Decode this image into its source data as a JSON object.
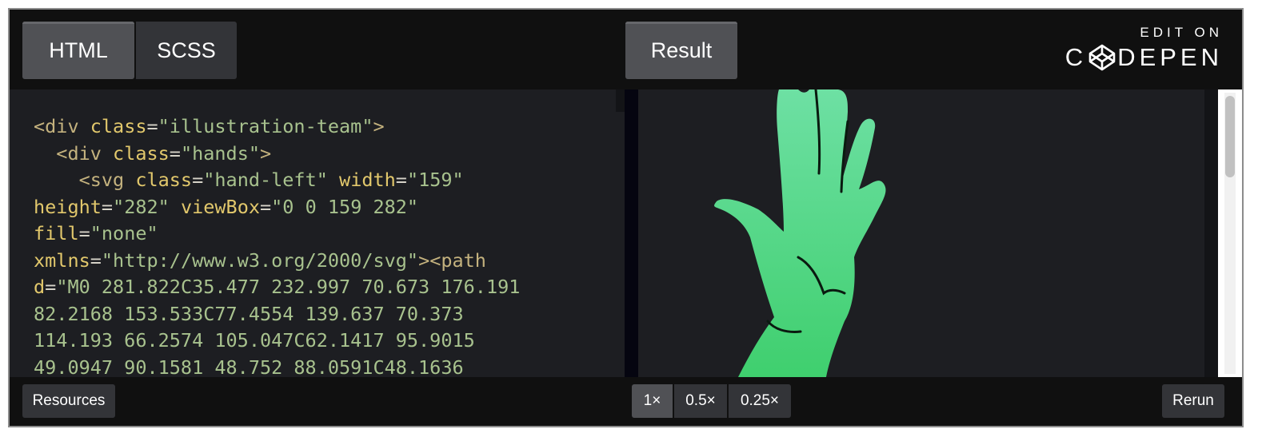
{
  "tabs": {
    "html": "HTML",
    "scss": "SCSS",
    "result": "Result"
  },
  "brand": {
    "edit_on": "EDIT ON",
    "codepen_prefix": "C",
    "codepen_suffix": "DEPEN"
  },
  "code_lines": [
    [
      [
        "tg",
        "<div "
      ],
      [
        "at",
        "class"
      ],
      [
        "p",
        "="
      ],
      [
        "v",
        "\"illustration-team\""
      ],
      [
        "tg",
        ">"
      ]
    ],
    [
      [
        "tg",
        "  <div "
      ],
      [
        "at",
        "class"
      ],
      [
        "p",
        "="
      ],
      [
        "v",
        "\"hands\""
      ],
      [
        "tg",
        ">"
      ]
    ],
    [
      [
        "tg",
        "    <svg "
      ],
      [
        "at",
        "class"
      ],
      [
        "p",
        "="
      ],
      [
        "v",
        "\"hand-left\""
      ],
      [
        "p",
        " "
      ],
      [
        "at",
        "width"
      ],
      [
        "p",
        "="
      ],
      [
        "v",
        "\"159\""
      ]
    ],
    [
      [
        "at",
        "height"
      ],
      [
        "p",
        "="
      ],
      [
        "v",
        "\"282\""
      ],
      [
        "p",
        " "
      ],
      [
        "at",
        "viewBox"
      ],
      [
        "p",
        "="
      ],
      [
        "v",
        "\"0 0 159 282\""
      ]
    ],
    [
      [
        "at",
        "fill"
      ],
      [
        "p",
        "="
      ],
      [
        "v",
        "\"none\""
      ]
    ],
    [
      [
        "at",
        "xmlns"
      ],
      [
        "p",
        "="
      ],
      [
        "v",
        "\"http://www.w3.org/2000/svg\""
      ],
      [
        "tg",
        "><path"
      ]
    ],
    [
      [
        "at",
        "d"
      ],
      [
        "p",
        "="
      ],
      [
        "v",
        "\"M0 281.822C35.477 232.997 70.673 176.191"
      ]
    ],
    [
      [
        "v",
        "82.2168 153.533C77.4554 139.637 70.373"
      ]
    ],
    [
      [
        "v",
        "114.193 66.2574 105.047C62.1417 95.9015"
      ]
    ],
    [
      [
        "v",
        "49.0947 90.1581 48.752 88.0591C48.1636"
      ]
    ]
  ],
  "bottom": {
    "resources": "Resources",
    "zoom_1x": "1×",
    "zoom_05x": "0.5×",
    "zoom_025x": "0.25×",
    "rerun": "Rerun"
  },
  "colors": {
    "hand_top": "#6ee0a4",
    "hand_bottom": "#3fcf6e"
  },
  "icons": {
    "codepen_logo": "codepen-cube-icon",
    "hand_illustration": "raised-hand-illustration"
  }
}
